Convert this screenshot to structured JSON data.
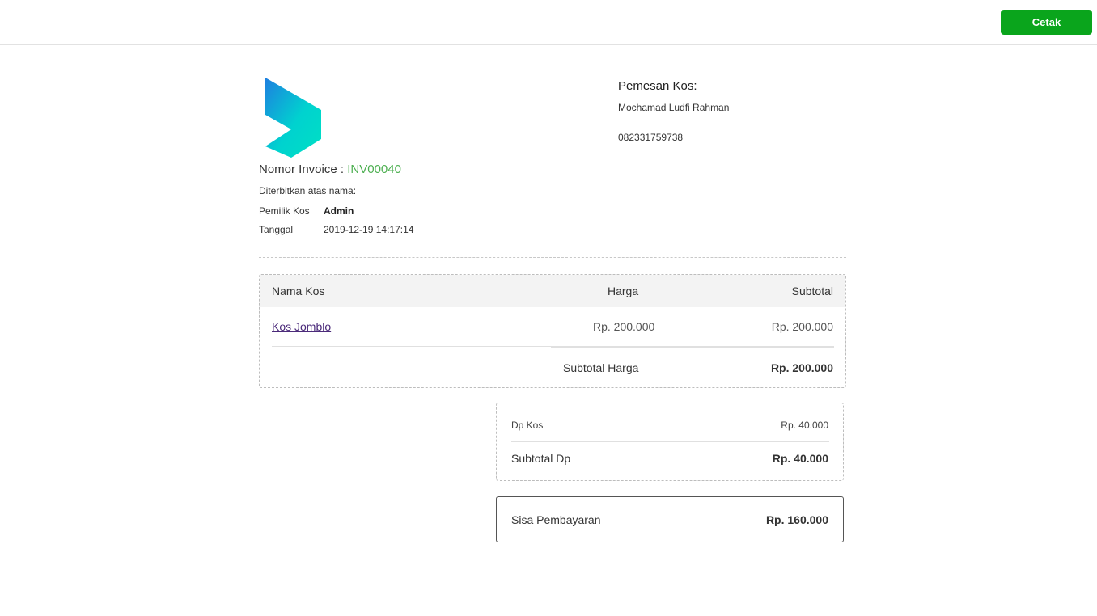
{
  "toolbar": {
    "print_label": "Cetak"
  },
  "colors": {
    "accent_green": "#0aa51c",
    "invoice_green": "#4caf50",
    "link_purple": "#4b2a7a"
  },
  "header": {
    "invoice_label": "Nomor Invoice : ",
    "invoice_number": "INV00040",
    "issued_for": "Diterbitkan atas nama:",
    "owner_label": "Pemilik Kos",
    "owner_value": "Admin",
    "date_label": "Tanggal",
    "date_value": "2019-12-19 14:17:14"
  },
  "customer": {
    "title": "Pemesan Kos:",
    "name": "Mochamad Ludfi Rahman",
    "phone": "082331759738"
  },
  "items": {
    "columns": [
      "Nama Kos",
      "Harga",
      "Subtotal"
    ],
    "rows": [
      {
        "name": "Kos Jomblo",
        "price": "Rp. 200.000",
        "subtotal": "Rp. 200.000"
      }
    ],
    "total_label": "Subtotal Harga",
    "total_value": "Rp. 200.000"
  },
  "dp": {
    "label": "Dp Kos",
    "value": "Rp. 40.000",
    "total_label": "Subtotal Dp",
    "total_value": "Rp. 40.000"
  },
  "remaining": {
    "label": "Sisa Pembayaran",
    "value": "Rp. 160.000"
  }
}
